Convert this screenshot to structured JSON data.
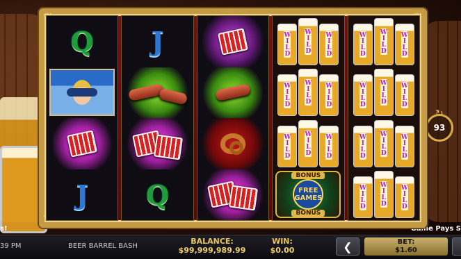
{
  "game": {
    "title": "BEER BARREL BASH",
    "clock": "39 PM",
    "edge_left_text": "s!",
    "edge_right_text": "Game Pays S",
    "spins_remaining": "93"
  },
  "reels": [
    [
      "Q",
      "girl",
      "accordion",
      "J"
    ],
    [
      "J",
      "sausage",
      "accordion",
      "Q"
    ],
    [
      "accordion",
      "sausage",
      "pretzel",
      "accordion"
    ],
    [
      "wild",
      "wild",
      "wild",
      "bonus"
    ],
    [
      "wild",
      "wild",
      "wild",
      "wild"
    ]
  ],
  "symbols": {
    "wild_label": "WILD",
    "bonus_label": "BONUS",
    "bonus_center": "FREE GAMES"
  },
  "status": {
    "balance_label": "BALANCE:",
    "balance_value": "$99,999,989.99",
    "win_label": "WIN:",
    "win_value": "$0.00",
    "bet_label": "BET:",
    "bet_value": "$1.60",
    "prev_bet_icon": "chevron-left-icon"
  },
  "colors": {
    "frame_gold": "#c49a44",
    "frame_red": "#7a1010",
    "accent_gold": "#e8c85a"
  }
}
